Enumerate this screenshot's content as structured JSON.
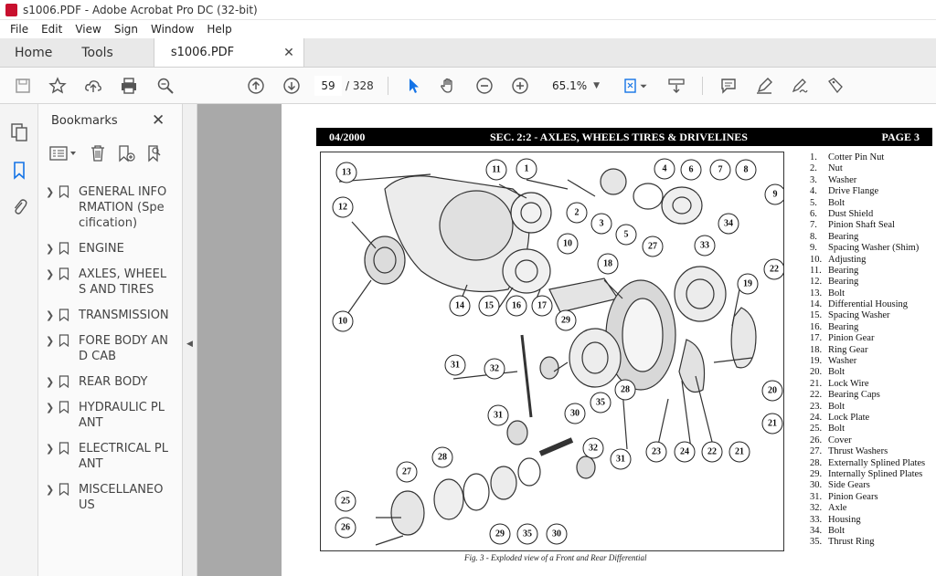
{
  "window": {
    "title": "s1006.PDF - Adobe Acrobat Pro DC (32-bit)"
  },
  "menu": [
    "File",
    "Edit",
    "View",
    "Sign",
    "Window",
    "Help"
  ],
  "tabs": {
    "home": "Home",
    "tools": "Tools",
    "document": "s1006.PDF"
  },
  "toolbar": {
    "current_page": "59",
    "page_total": "/ 328",
    "zoom": "65.1%"
  },
  "bookmarks": {
    "header": "Bookmarks",
    "items": [
      {
        "label": "GENERAL INFORMATION (Specification)"
      },
      {
        "label": "ENGINE"
      },
      {
        "label": "AXLES, WHEELS AND TIRES"
      },
      {
        "label": "TRANSMISSION"
      },
      {
        "label": "FORE BODY AND CAB"
      },
      {
        "label": "REAR BODY"
      },
      {
        "label": "HYDRAULIC PLANT"
      },
      {
        "label": "ELECTRICAL PLANT"
      },
      {
        "label": "MISCELLANEOUS"
      }
    ]
  },
  "document": {
    "header_left": "04/2000",
    "header_center": "SEC. 2:2 - AXLES, WHEELS TIRES & DRIVELINES",
    "header_right": "PAGE 3",
    "caption": "Fig. 3 - Exploded view of a Front and Rear Differential",
    "parts": [
      "Cotter Pin Nut",
      "Nut",
      "Washer",
      "Drive Flange",
      "Bolt",
      "Dust Shield",
      "Pinion Shaft Seal",
      "Bearing",
      "Spacing Washer (Shim)",
      "Adjusting",
      "Bearing",
      "Bearing",
      "Bolt",
      "Differential Housing",
      "Spacing Washer",
      "Bearing",
      "Pinion Gear",
      "Ring Gear",
      "Washer",
      "Bolt",
      "Lock Wire",
      "Bearing Caps",
      "Bolt",
      "Lock Plate",
      "Bolt",
      "Cover",
      "Thrust Washers",
      "Externally Splined Plates",
      "Internally Splined Plates",
      "Side Gears",
      "Pinion Gears",
      "Axle",
      "Housing",
      "Bolt",
      "Thrust Ring"
    ],
    "callouts": [
      "13",
      "11",
      "1",
      "4",
      "6",
      "7",
      "8",
      "9",
      "12",
      "2",
      "3",
      "5",
      "10",
      "27",
      "33",
      "34",
      "22",
      "18",
      "19",
      "14",
      "15",
      "16",
      "17",
      "10",
      "29",
      "31",
      "32",
      "30",
      "35",
      "28",
      "20",
      "21",
      "23",
      "24",
      "22",
      "21",
      "31",
      "32",
      "31",
      "28",
      "27",
      "25",
      "26",
      "29",
      "35",
      "30"
    ]
  }
}
